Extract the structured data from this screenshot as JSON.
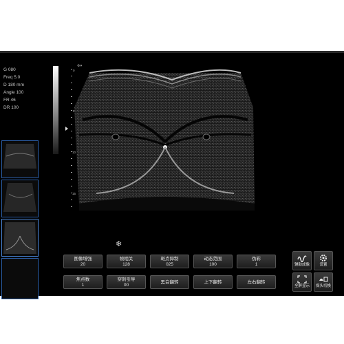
{
  "params": [
    {
      "key": "G",
      "value": "080"
    },
    {
      "key": "Freq",
      "value": "5.0"
    },
    {
      "key": "D",
      "value": "180 mm"
    },
    {
      "key": "Angle",
      "value": "100"
    },
    {
      "key": "FR",
      "value": "46"
    },
    {
      "key": "DR",
      "value": "100"
    }
  ],
  "depth_labels": [
    "0",
    "5",
    "10",
    "15"
  ],
  "freeze_icon": "snowflake-icon",
  "controls": {
    "row1": [
      {
        "name": "图像增强",
        "value": "20"
      },
      {
        "name": "帧相关",
        "value": "128"
      },
      {
        "name": "斑点抑制",
        "value": "025"
      },
      {
        "name": "动态范围",
        "value": "100"
      },
      {
        "name": "伪彩",
        "value": "1"
      }
    ],
    "row2": [
      {
        "name": "焦点数",
        "value": "1"
      },
      {
        "name": "穿刺引导",
        "value": "00"
      },
      {
        "name": "黑白翻转",
        "value": ""
      },
      {
        "name": "上下翻转",
        "value": ""
      },
      {
        "name": "左右翻转",
        "value": ""
      }
    ]
  },
  "side_buttons": [
    {
      "label": "辅助成像",
      "icon": "waveform-icon"
    },
    {
      "label": "设置",
      "icon": "gear-icon"
    },
    {
      "label": "全屏显示",
      "icon": "fullscreen-icon"
    },
    {
      "label": "探头切换",
      "icon": "probe-switch-icon"
    }
  ]
}
